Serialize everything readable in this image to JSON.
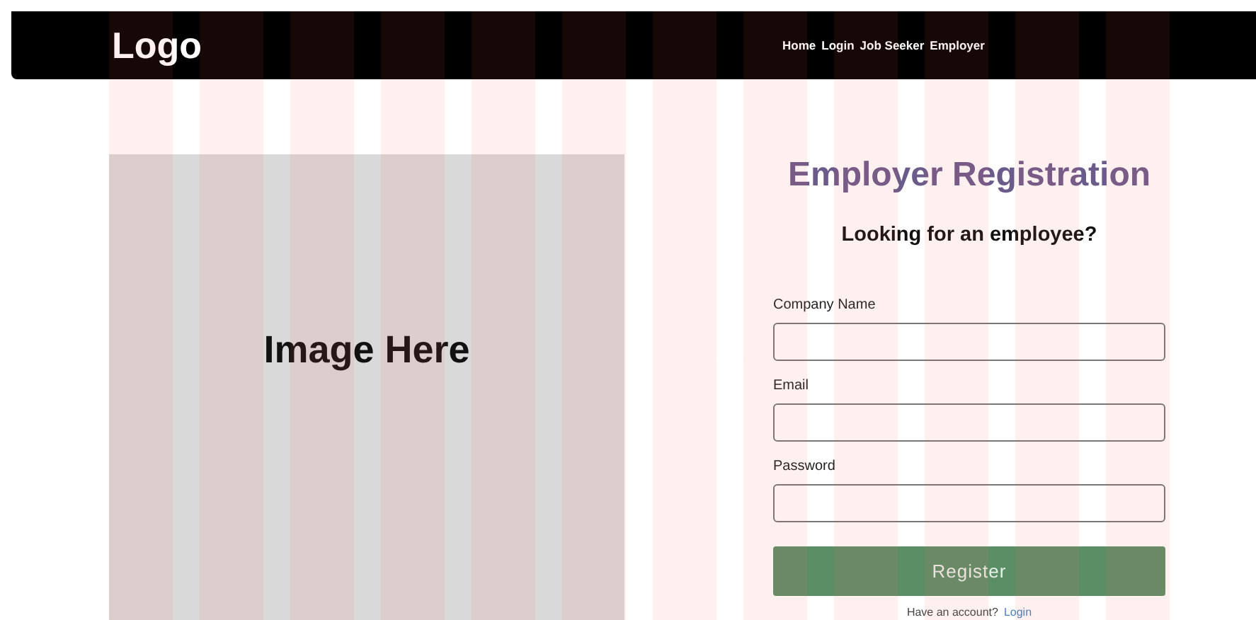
{
  "header": {
    "logo": "Logo",
    "nav": [
      "Home",
      "Login",
      "Job Seeker",
      "Employer"
    ]
  },
  "image_placeholder": {
    "label": "Image Here"
  },
  "form": {
    "title": "Employer Registration",
    "subtitle": "Looking for an employee?",
    "fields": [
      {
        "label": "Company Name"
      },
      {
        "label": "Email"
      },
      {
        "label": "Password"
      }
    ],
    "submit": "Register",
    "footer_text": "Have an account?",
    "footer_link": "Login"
  }
}
